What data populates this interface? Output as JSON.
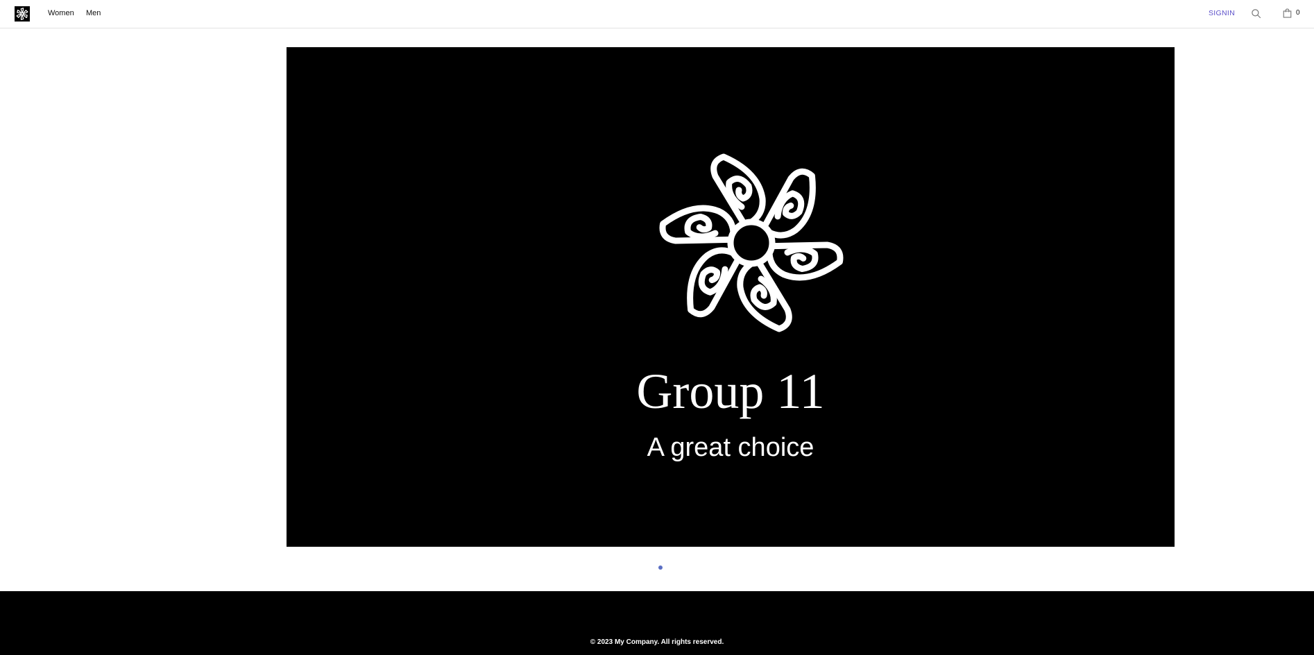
{
  "header": {
    "logo_alt": "Group 11 logo",
    "nav": [
      {
        "label": "Women"
      },
      {
        "label": "Men"
      }
    ],
    "signin_label": "SIGNIN",
    "search_icon": "search-icon",
    "cart_icon": "shopping-bag-icon",
    "cart_count": "0"
  },
  "hero": {
    "title": "Group 11",
    "subtitle": "A great choice",
    "emblem_icon": "flower-emblem-icon",
    "slides_total": 1,
    "active_slide": 1
  },
  "footer": {
    "copyright": "© 2023 My Company. All rights reserved."
  },
  "colors": {
    "accent": "#5b4fc9",
    "hero_bg": "#000000",
    "footer_bg": "#000000",
    "dot": "#5b6fc4"
  }
}
